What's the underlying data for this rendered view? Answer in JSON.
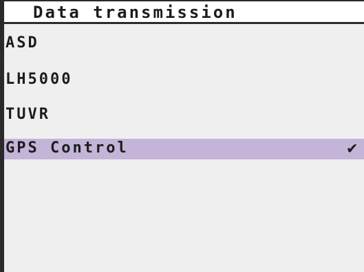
{
  "header": {
    "title": "Data transmission"
  },
  "menu": {
    "items": [
      {
        "label": "ASD",
        "selected": false
      },
      {
        "label": "LH5000",
        "selected": false
      },
      {
        "label": "TUVR",
        "selected": false
      },
      {
        "label": "GPS Control",
        "selected": true
      }
    ],
    "check_glyph": "✔"
  },
  "colors": {
    "selection_highlight": "#c3b4d8",
    "screen_background": "#efefef",
    "text": "#1c1c1c"
  }
}
